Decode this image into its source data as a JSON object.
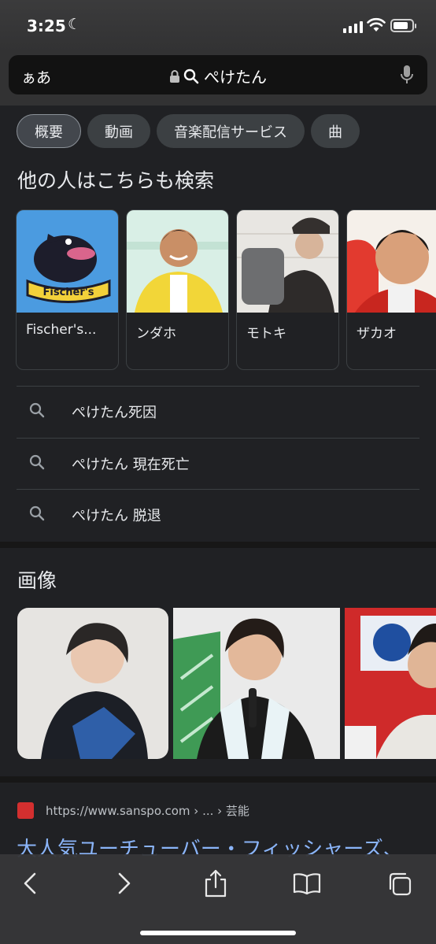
{
  "status": {
    "time": "3:25"
  },
  "address_bar": {
    "aa_label": "ぁあ",
    "query": "ぺけたん"
  },
  "chips": [
    {
      "label": "概要",
      "active": true
    },
    {
      "label": "動画",
      "active": false
    },
    {
      "label": "音楽配信サービス",
      "active": false
    },
    {
      "label": "曲",
      "active": false
    }
  ],
  "people_section": {
    "title": "他の人はこちらも検索",
    "people": [
      {
        "name": "Fischer's..."
      },
      {
        "name": "ンダホ"
      },
      {
        "name": "モトキ"
      },
      {
        "name": "ザカオ"
      }
    ]
  },
  "related_searches": [
    {
      "text": "ぺけたん死因"
    },
    {
      "text": "ぺけたん 現在死亡"
    },
    {
      "text": "ぺけたん 脱退"
    }
  ],
  "images_section": {
    "title": "画像"
  },
  "result": {
    "url": "https://www.sanspo.com › ... › 芸能",
    "title": "大人気ユーチューバー・フィッシャーズ、"
  },
  "colors": {
    "background": "#202124",
    "link": "#8ab4f8",
    "chip": "#3c4043"
  }
}
